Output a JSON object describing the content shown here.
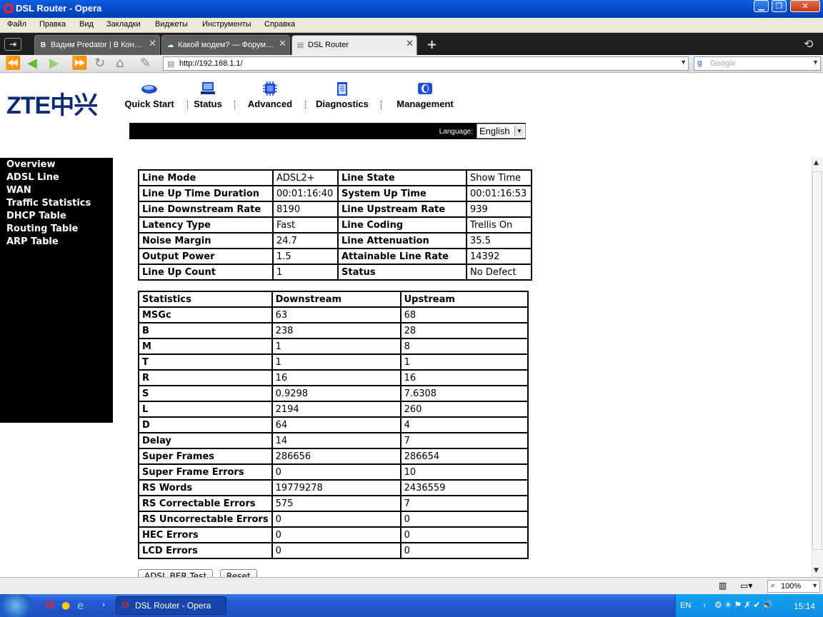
{
  "window": {
    "title": "DSL Router - Opera"
  },
  "menu": [
    "Файл",
    "Правка",
    "Вид",
    "Закладки",
    "Виджеты",
    "Инструменты",
    "Справка"
  ],
  "tabs": [
    {
      "label": "Вадим Predator | В Кон…",
      "active": false
    },
    {
      "label": "Какой модем? — Форум…",
      "active": false
    },
    {
      "label": "DSL Router",
      "active": true
    }
  ],
  "address": {
    "url": "http://192.168.1.1/",
    "search_placeholder": "Google"
  },
  "router": {
    "logo": "ZTE中兴",
    "nav": [
      "Quick Start",
      "Status",
      "Advanced",
      "Diagnostics",
      "Management"
    ],
    "language_label": "Language:",
    "language_value": "English",
    "sidebar": [
      "Overview",
      "ADSL Line",
      "WAN",
      "Traffic Statistics",
      "DHCP Table",
      "Routing Table",
      "ARP Table"
    ],
    "line_table": [
      [
        "Line Mode",
        "ADSL2+",
        "Line State",
        "Show Time"
      ],
      [
        "Line Up Time Duration",
        "00:01:16:40",
        "System Up Time",
        "00:01:16:53"
      ],
      [
        "Line Downstream Rate",
        "8190",
        "Line Upstream Rate",
        "939"
      ],
      [
        "Latency Type",
        "Fast",
        "Line Coding",
        "Trellis On"
      ],
      [
        "Noise Margin",
        "24.7",
        "Line Attenuation",
        "35.5"
      ],
      [
        "Output Power",
        "1.5",
        "Attainable Line Rate",
        "14392"
      ],
      [
        "Line Up Count",
        "1",
        "Status",
        "No Defect"
      ]
    ],
    "stats_header": [
      "Statistics",
      "Downstream",
      "Upstream"
    ],
    "stats_rows": [
      [
        "MSGc",
        "63",
        "68"
      ],
      [
        "B",
        "238",
        "28"
      ],
      [
        "M",
        "1",
        "8"
      ],
      [
        "T",
        "1",
        "1"
      ],
      [
        "R",
        "16",
        "16"
      ],
      [
        "S",
        "0.9298",
        "7.6308"
      ],
      [
        "L",
        "2194",
        "260"
      ],
      [
        "D",
        "64",
        "4"
      ],
      [
        "Delay",
        "14",
        "7"
      ],
      [
        "Super Frames",
        "286656",
        "286654"
      ],
      [
        "Super Frame Errors",
        "0",
        "10"
      ],
      [
        "RS Words",
        "19779278",
        "2436559"
      ],
      [
        "RS Correctable Errors",
        "575",
        "7"
      ],
      [
        "RS Uncorrectable Errors",
        "0",
        "0"
      ],
      [
        "HEC Errors",
        "0",
        "0"
      ],
      [
        "LCD Errors",
        "0",
        "0"
      ]
    ],
    "buttons": {
      "ber_test": "ADSL BER Test",
      "reset": "Reset"
    }
  },
  "statusbar": {
    "zoom": "100%"
  },
  "taskbar": {
    "item": "DSL Router - Opera",
    "lang": "EN",
    "clock": "15:14"
  }
}
